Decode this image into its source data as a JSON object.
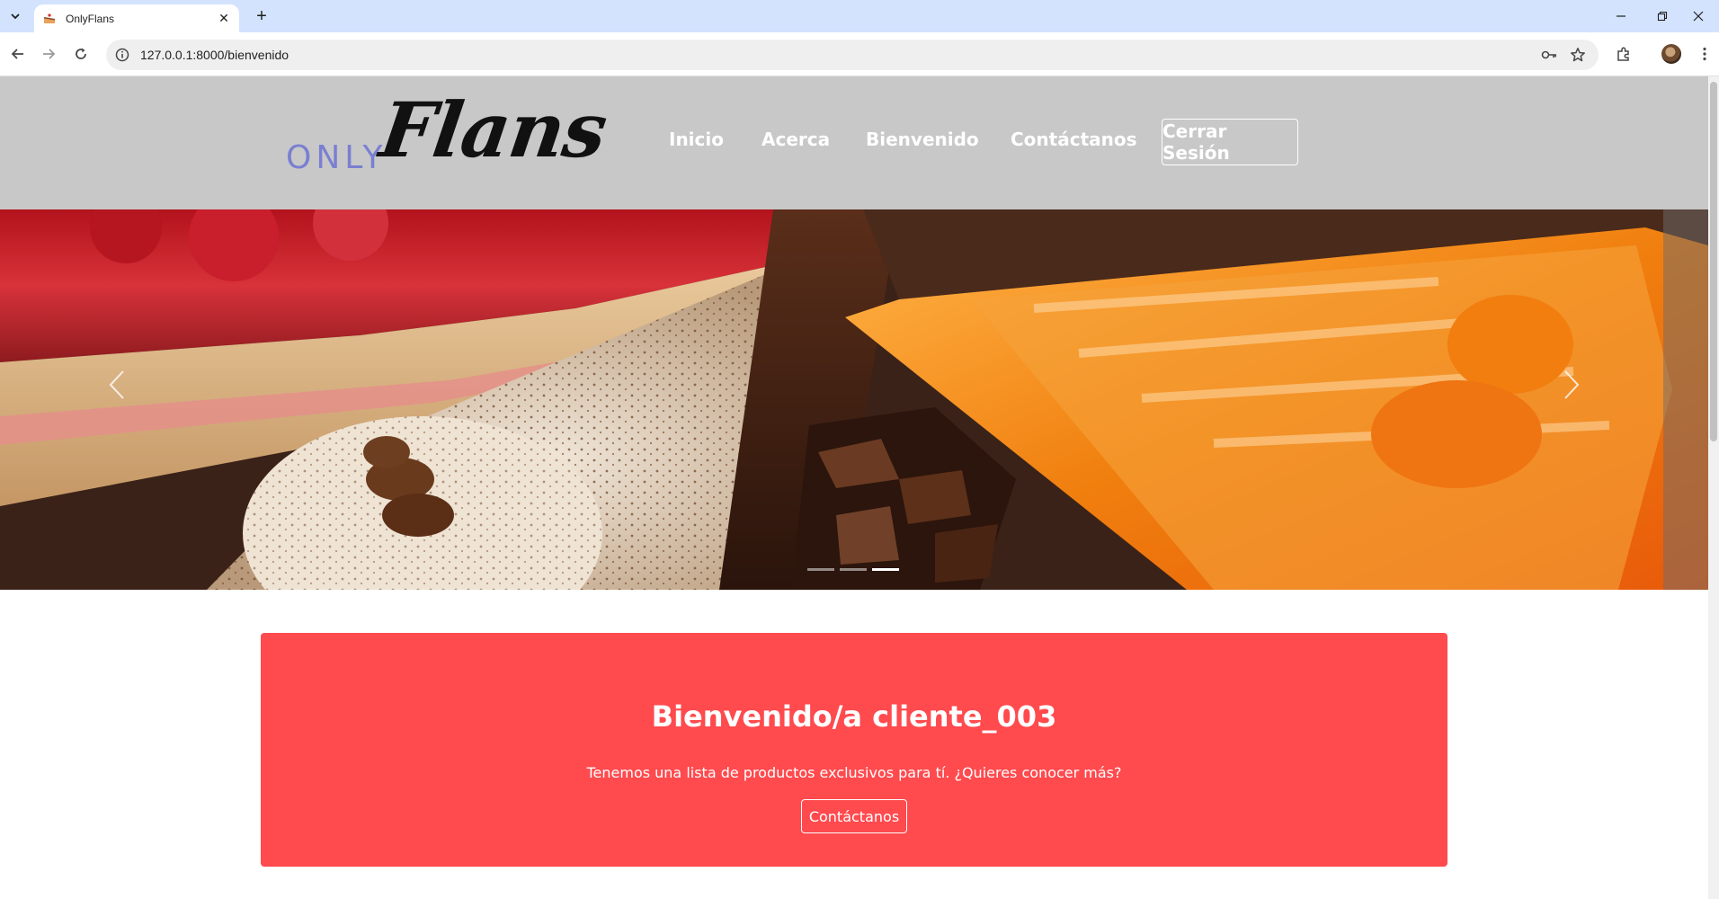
{
  "browser": {
    "tab_title": "OnlyFlans",
    "url": "127.0.0.1:8000/bienvenido"
  },
  "site": {
    "logo_only": "ONLY",
    "logo_flans": "Flans",
    "nav": [
      "Inicio",
      "Acerca",
      "Bienvenido",
      "Contáctanos"
    ],
    "logout_label": "Cerrar Sesión"
  },
  "carousel": {
    "slide_count": 3,
    "active_slide": 3
  },
  "welcome": {
    "title": "Bienvenido/a cliente_003",
    "text": "Tenemos una lista de productos exclusivos para tí. ¿Quieres conocer más?",
    "button_label": "Contáctanos"
  },
  "colors": {
    "navbar": "#c8c8c8",
    "welcome_box": "#ff4a4e",
    "logo_only": "#7a7fd1",
    "chrome_tabbar": "#d3e3fd"
  },
  "icons": [
    "tab-search-icon",
    "cake-favicon-icon",
    "close-icon",
    "plus-icon",
    "minimize-icon",
    "restore-icon",
    "close-window-icon",
    "back-icon",
    "forward-icon",
    "reload-icon",
    "info-icon",
    "key-icon",
    "star-icon",
    "extensions-icon",
    "menu-dots-icon",
    "chevron-left-icon",
    "chevron-right-icon"
  ]
}
